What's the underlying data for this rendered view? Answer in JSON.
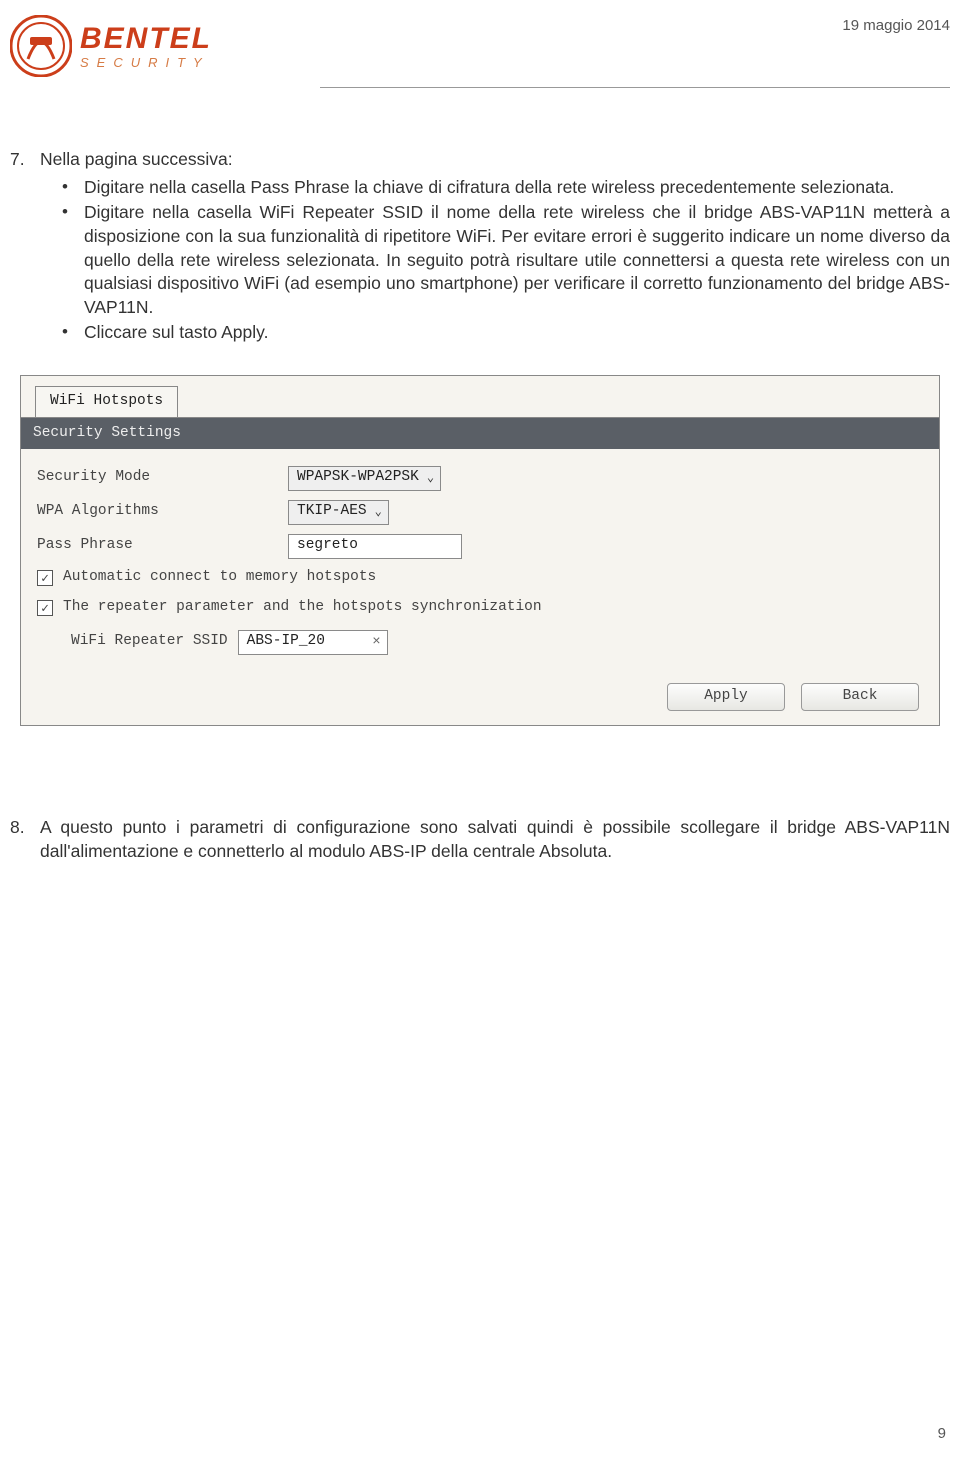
{
  "header": {
    "logo_main": "BENTEL",
    "logo_sub": "SECURITY",
    "date": "19 maggio 2014"
  },
  "section7": {
    "num": "7",
    "intro": "Nella pagina successiva:",
    "bullets": [
      "Digitare nella casella Pass Phrase la chiave di cifratura della rete wireless precedentemente selezionata.",
      "Digitare nella casella WiFi Repeater SSID il nome della rete wireless che il bridge ABS-VAP11N metterà a disposizione con la sua funzionalità di ripetitore WiFi. Per evitare errori è suggerito indicare un nome diverso da quello della rete wireless selezionata. In seguito potrà risultare utile connettersi a questa rete wireless con un qualsiasi dispositivo WiFi (ad esempio uno smartphone) per verificare il corretto funzionamento del bridge ABS-VAP11N.",
      "Cliccare sul tasto Apply."
    ]
  },
  "figure": {
    "tab": "WiFi Hotspots",
    "panel_title": "Security Settings",
    "security_mode": {
      "label": "Security Mode",
      "value": "WPAPSK-WPA2PSK"
    },
    "wpa_algorithms": {
      "label": "WPA Algorithms",
      "value": "TKIP-AES"
    },
    "pass_phrase": {
      "label": "Pass Phrase",
      "value": "segreto"
    },
    "check1": "Automatic connect to memory hotspots",
    "check2": "The repeater parameter and the hotspots synchronization",
    "ssid": {
      "label": "WiFi Repeater SSID",
      "value": "ABS-IP_20"
    },
    "apply": "Apply",
    "back": "Back"
  },
  "section8": {
    "num": "8",
    "text": "A questo punto i parametri di configurazione sono salvati quindi è possibile scollegare il bridge ABS-VAP11N dall'alimentazione e connetterlo al modulo ABS-IP della centrale Absoluta."
  },
  "page_number": "9"
}
